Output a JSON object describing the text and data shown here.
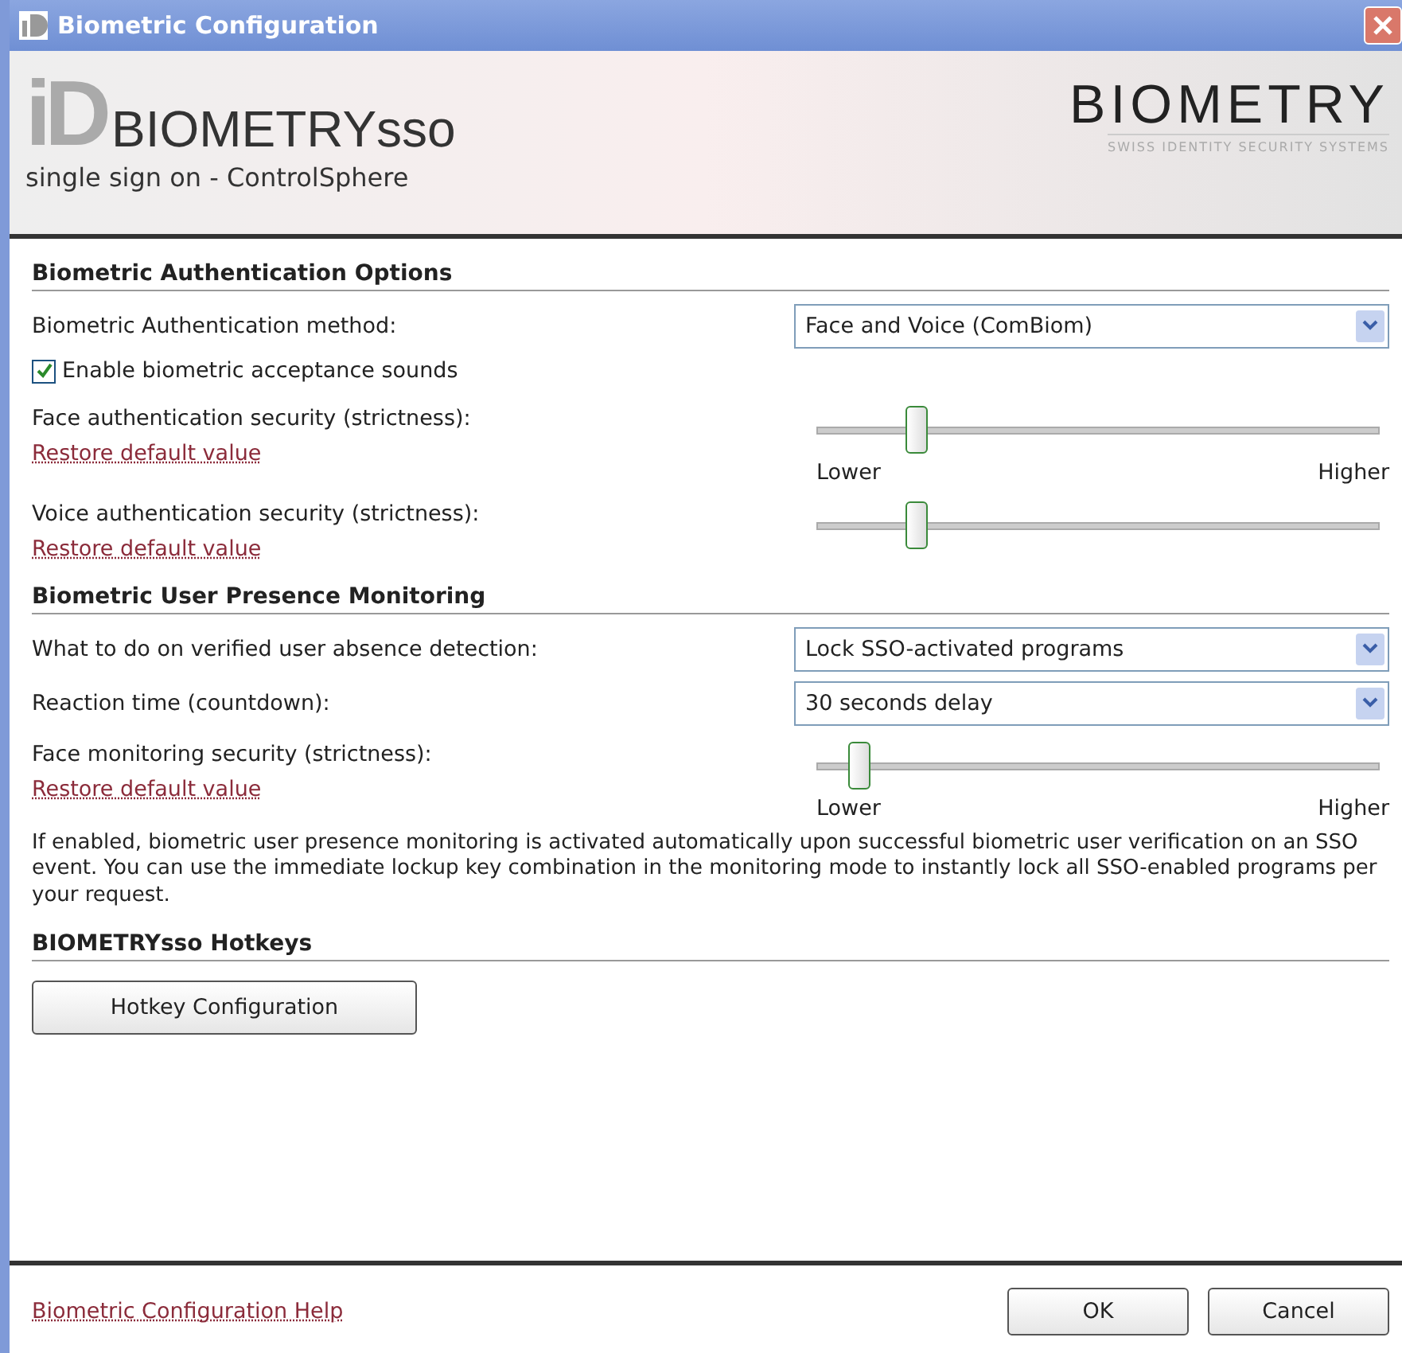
{
  "window": {
    "title": "Biometric Configuration"
  },
  "header": {
    "logo_mark": "iD",
    "product": "BIOMETRYsso",
    "subtitle": "single sign on - ControlSphere",
    "brand": "BIOMETRY",
    "tagline": "SWISS IDENTITY SECURITY SYSTEMS"
  },
  "sections": [
    {
      "title": "Biometric Authentication Options",
      "rows": [
        {
          "kind": "select",
          "label": "Biometric Authentication method:",
          "value": "Face and Voice (ComBiom)"
        },
        {
          "kind": "checkbox",
          "label": "Enable biometric acceptance sounds",
          "checked": true
        },
        {
          "kind": "slider",
          "label": "Face authentication security (strictness):",
          "link": "Restore default value",
          "level": 0.18,
          "low": "Lower",
          "high": "Higher"
        },
        {
          "kind": "slider",
          "label": "Voice authentication security (strictness):",
          "link": "Restore default value",
          "level": 0.18
        }
      ]
    },
    {
      "title": "Biometric User Presence Monitoring",
      "rows": [
        {
          "kind": "select",
          "label": "What to do on verified user absence detection:",
          "value": "Lock SSO-activated programs"
        },
        {
          "kind": "select",
          "label": "Reaction time (countdown):",
          "value": "30 seconds delay"
        },
        {
          "kind": "slider",
          "label": "Face monitoring security (strictness):",
          "link": "Restore default value",
          "level": 0.08,
          "low": "Lower",
          "high": "Higher"
        },
        {
          "kind": "note",
          "text": "If enabled, biometric user presence monitoring is activated automatically upon successful biometric user verification on an SSO event. You can use the immediate lockup key combination in the monitoring mode to instantly lock all SSO-enabled programs per your request."
        }
      ]
    },
    {
      "title": "BIOMETRYsso Hotkeys",
      "rows": [
        {
          "kind": "button",
          "label": "Hotkey Configuration"
        }
      ]
    }
  ],
  "footer": {
    "help_link": "Biometric Configuration Help",
    "buttons": [
      "OK",
      "Cancel"
    ]
  }
}
